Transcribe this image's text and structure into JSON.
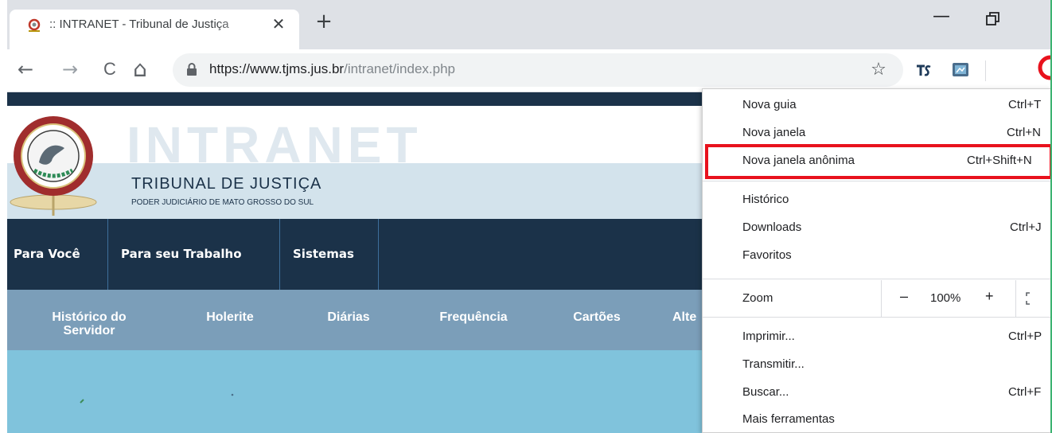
{
  "browser": {
    "tab": {
      "title": ":: INTRANET - Tribunal de Justiça",
      "close_glyph": "✕"
    },
    "new_tab_glyph": "+",
    "window": {
      "minimize_glyph": "—"
    },
    "toolbar": {
      "back_glyph": "←",
      "forward_glyph": "→",
      "reload_glyph": "C",
      "home_glyph": "⌂",
      "url_main": "https://www.tjms.jus.br",
      "url_path": "/intranet/index.php",
      "star_glyph": "☆"
    }
  },
  "site": {
    "brand_word": "INTRANET",
    "org_title": "TRIBUNAL DE JUSTIÇA",
    "org_subtitle": "PODER JUDICIÁRIO DE MATO GROSSO DO SUL",
    "nav": [
      "Para Você",
      "Para seu Trabalho",
      "Sistemas"
    ],
    "subnav": [
      {
        "line1": "Histórico do",
        "line2": "Servidor"
      },
      {
        "line1": "Holerite",
        "line2": ""
      },
      {
        "line1": "Diárias",
        "line2": ""
      },
      {
        "line1": "Frequência",
        "line2": ""
      },
      {
        "line1": "Cartões",
        "line2": ""
      },
      {
        "line1": "Alte",
        "line2": ""
      }
    ],
    "colors": {
      "dark_navy": "#1b3249",
      "subnav_blue": "#7b9eb9",
      "content_blue": "#80c3dc"
    }
  },
  "menu": {
    "items": [
      {
        "label": "Nova guia",
        "shortcut": "Ctrl+T"
      },
      {
        "label": "Nova janela",
        "shortcut": "Ctrl+N"
      },
      {
        "label": "Nova janela anônima",
        "shortcut": "Ctrl+Shift+N"
      },
      {
        "label": "Histórico",
        "shortcut": ""
      },
      {
        "label": "Downloads",
        "shortcut": "Ctrl+J"
      },
      {
        "label": "Favoritos",
        "shortcut": ""
      },
      {
        "label": "Zoom",
        "shortcut": ""
      },
      {
        "label": "Imprimir...",
        "shortcut": "Ctrl+P"
      },
      {
        "label": "Transmitir...",
        "shortcut": ""
      },
      {
        "label": "Buscar...",
        "shortcut": "Ctrl+F"
      },
      {
        "label": "Mais ferramentas",
        "shortcut": ""
      }
    ],
    "zoom": {
      "minus": "–",
      "value": "100%",
      "plus": "+"
    },
    "highlight_color": "#e8121d"
  }
}
